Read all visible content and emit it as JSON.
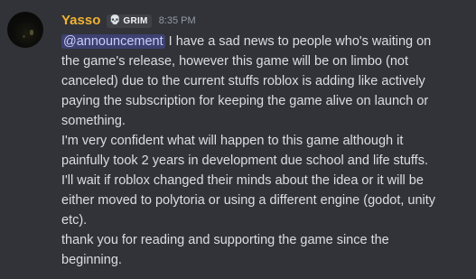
{
  "message": {
    "username": "Yasso",
    "tag": {
      "icon": "skull-icon",
      "label": "GRIM"
    },
    "timestamp": "8:35 PM",
    "colors": {
      "background": "#313338",
      "username": "#f0b232",
      "text": "#dbdee1",
      "timestamp": "#949ba4",
      "mention_bg": "#5865f2",
      "mention_text": "#c9cdfb"
    },
    "mention": "@announcement",
    "lines": [
      " I have a sad news to people who's waiting on",
      "the game's release, however this game will be on limbo (not",
      "canceled) due to the current stuffs roblox is adding like actively",
      "paying the subscription for keeping the game alive on launch or",
      "something.",
      "I'm very confident what will happen to this game although it",
      "painfully took 2 years in development due school and life stuffs.",
      "I'll wait if roblox changed their minds about the idea or it will be",
      "either moved to polytoria or using a different engine (godot, unity",
      "etc).",
      "thank you for reading and supporting the game since the",
      "beginning."
    ]
  }
}
